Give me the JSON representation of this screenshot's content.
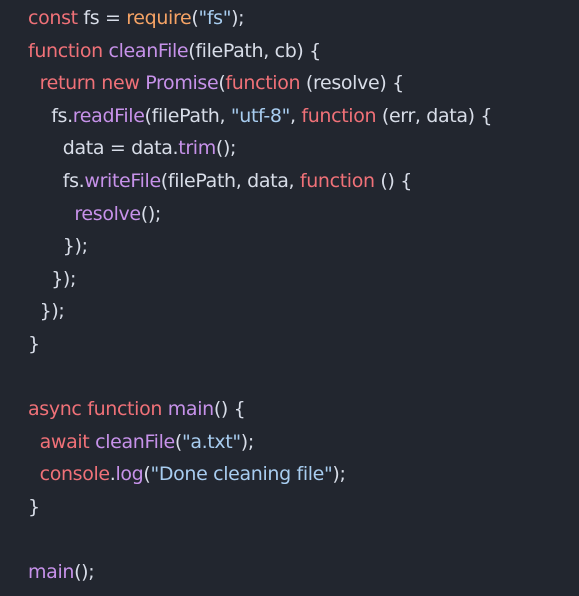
{
  "editor": {
    "language": "javascript",
    "colors": {
      "background": "#22262f",
      "plain": "#d8dde8",
      "keyword": "#f07178",
      "function": "#c792ea",
      "string": "#a8cdf0",
      "builtin": "#f6a365"
    },
    "lines": [
      {
        "indent": 0,
        "tokens": [
          {
            "t": "keyword",
            "v": "const"
          },
          {
            "t": "plain",
            "v": " fs = "
          },
          {
            "t": "builtin",
            "v": "require"
          },
          {
            "t": "plain",
            "v": "("
          },
          {
            "t": "string",
            "v": "\"fs\""
          },
          {
            "t": "plain",
            "v": ");"
          }
        ]
      },
      {
        "indent": 0,
        "tokens": [
          {
            "t": "keyword",
            "v": "function"
          },
          {
            "t": "plain",
            "v": " "
          },
          {
            "t": "function",
            "v": "cleanFile"
          },
          {
            "t": "plain",
            "v": "(filePath, cb) {"
          }
        ]
      },
      {
        "indent": 1,
        "tokens": [
          {
            "t": "keyword",
            "v": "return"
          },
          {
            "t": "plain",
            "v": " "
          },
          {
            "t": "keyword",
            "v": "new"
          },
          {
            "t": "plain",
            "v": " "
          },
          {
            "t": "function",
            "v": "Promise"
          },
          {
            "t": "plain",
            "v": "("
          },
          {
            "t": "keyword",
            "v": "function"
          },
          {
            "t": "plain",
            "v": " (resolve) {"
          }
        ]
      },
      {
        "indent": 2,
        "tokens": [
          {
            "t": "plain",
            "v": "fs."
          },
          {
            "t": "function",
            "v": "readFile"
          },
          {
            "t": "plain",
            "v": "(filePath, "
          },
          {
            "t": "string",
            "v": "\"utf-8\""
          },
          {
            "t": "plain",
            "v": ", "
          },
          {
            "t": "keyword",
            "v": "function"
          },
          {
            "t": "plain",
            "v": " (err, data) {"
          }
        ]
      },
      {
        "indent": 3,
        "tokens": [
          {
            "t": "plain",
            "v": "data = data."
          },
          {
            "t": "function",
            "v": "trim"
          },
          {
            "t": "plain",
            "v": "();"
          }
        ]
      },
      {
        "indent": 3,
        "tokens": [
          {
            "t": "plain",
            "v": "fs."
          },
          {
            "t": "function",
            "v": "writeFile"
          },
          {
            "t": "plain",
            "v": "(filePath, data, "
          },
          {
            "t": "keyword",
            "v": "function"
          },
          {
            "t": "plain",
            "v": " () {"
          }
        ]
      },
      {
        "indent": 4,
        "tokens": [
          {
            "t": "function",
            "v": "resolve"
          },
          {
            "t": "plain",
            "v": "();"
          }
        ]
      },
      {
        "indent": 3,
        "tokens": [
          {
            "t": "plain",
            "v": "});"
          }
        ]
      },
      {
        "indent": 2,
        "tokens": [
          {
            "t": "plain",
            "v": "});"
          }
        ]
      },
      {
        "indent": 1,
        "tokens": [
          {
            "t": "plain",
            "v": "});"
          }
        ]
      },
      {
        "indent": 0,
        "tokens": [
          {
            "t": "plain",
            "v": "}"
          }
        ]
      },
      {
        "indent": 0,
        "tokens": []
      },
      {
        "indent": 0,
        "tokens": [
          {
            "t": "keyword",
            "v": "async"
          },
          {
            "t": "plain",
            "v": " "
          },
          {
            "t": "keyword",
            "v": "function"
          },
          {
            "t": "plain",
            "v": " "
          },
          {
            "t": "function",
            "v": "main"
          },
          {
            "t": "plain",
            "v": "() {"
          }
        ]
      },
      {
        "indent": 1,
        "tokens": [
          {
            "t": "keyword",
            "v": "await"
          },
          {
            "t": "plain",
            "v": " "
          },
          {
            "t": "function",
            "v": "cleanFile"
          },
          {
            "t": "plain",
            "v": "("
          },
          {
            "t": "string",
            "v": "\"a.txt\""
          },
          {
            "t": "plain",
            "v": ");"
          }
        ]
      },
      {
        "indent": 1,
        "tokens": [
          {
            "t": "keyword",
            "v": "console"
          },
          {
            "t": "plain",
            "v": "."
          },
          {
            "t": "function",
            "v": "log"
          },
          {
            "t": "plain",
            "v": "("
          },
          {
            "t": "string",
            "v": "\"Done cleaning file\""
          },
          {
            "t": "plain",
            "v": ");"
          }
        ]
      },
      {
        "indent": 0,
        "tokens": [
          {
            "t": "plain",
            "v": "}"
          }
        ]
      },
      {
        "indent": 0,
        "tokens": []
      },
      {
        "indent": 0,
        "tokens": [
          {
            "t": "function",
            "v": "main"
          },
          {
            "t": "plain",
            "v": "();"
          }
        ]
      }
    ]
  }
}
